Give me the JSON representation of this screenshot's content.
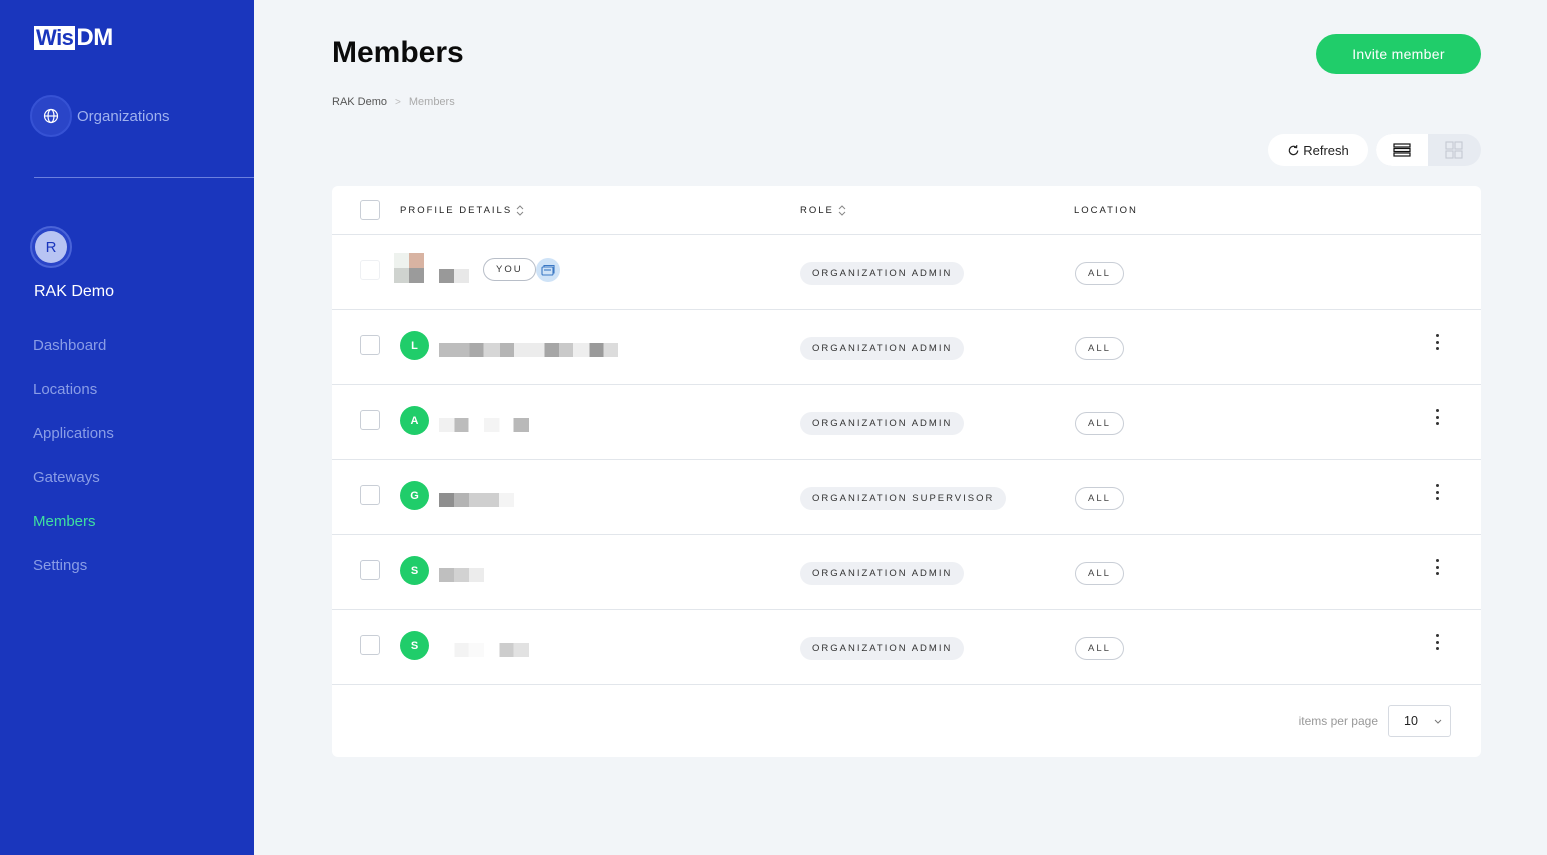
{
  "logo": {
    "part1": "Wis",
    "part2": "DM"
  },
  "sidebar": {
    "organizations_label": "Organizations",
    "user_initial": "R",
    "org_name": "RAK Demo",
    "nav": [
      {
        "label": "Dashboard",
        "active": false
      },
      {
        "label": "Locations",
        "active": false
      },
      {
        "label": "Applications",
        "active": false
      },
      {
        "label": "Gateways",
        "active": false
      },
      {
        "label": "Members",
        "active": true
      },
      {
        "label": "Settings",
        "active": false
      }
    ]
  },
  "header": {
    "title": "Members",
    "invite_label": "Invite member",
    "breadcrumb": [
      "RAK Demo",
      "Members"
    ]
  },
  "toolbar": {
    "refresh_label": "Refresh",
    "view_mode": "list"
  },
  "table": {
    "columns": {
      "profile": "PROFILE DETAILS",
      "role": "ROLE",
      "location": "LOCATION"
    },
    "rows": [
      {
        "initial": "",
        "is_you": true,
        "you_label": "YOU",
        "role": "ORGANIZATION ADMIN",
        "location": "ALL"
      },
      {
        "initial": "L",
        "is_you": false,
        "role": "ORGANIZATION ADMIN",
        "location": "ALL"
      },
      {
        "initial": "A",
        "is_you": false,
        "role": "ORGANIZATION ADMIN",
        "location": "ALL"
      },
      {
        "initial": "G",
        "is_you": false,
        "role": "ORGANIZATION SUPERVISOR",
        "location": "ALL"
      },
      {
        "initial": "S",
        "is_you": false,
        "role": "ORGANIZATION ADMIN",
        "location": "ALL"
      },
      {
        "initial": "S",
        "is_you": false,
        "role": "ORGANIZATION ADMIN",
        "location": "ALL"
      }
    ]
  },
  "pagination": {
    "label": "items per page",
    "value": "10"
  },
  "colors": {
    "sidebar": "#1a36bd",
    "accent": "#20cd6a",
    "active_nav": "#3fe0a0"
  }
}
